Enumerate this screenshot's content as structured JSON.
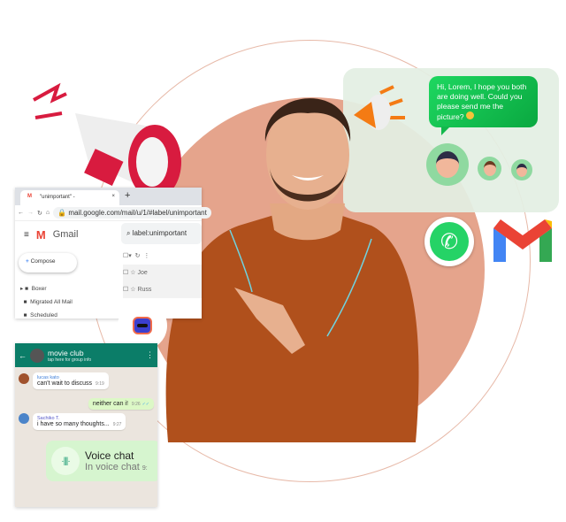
{
  "gmail": {
    "tab_title": "\"unimportant\" - ",
    "url": "mail.google.com/mail/u/1/#label/unimportant",
    "brand": "Gmail",
    "search_value": "label:unimportant",
    "compose_label": "Compose",
    "labels": [
      "Boxer",
      "Migrated All Mail",
      "Scheduled"
    ],
    "rows": [
      "Joe",
      "Russ"
    ]
  },
  "whatsapp": {
    "group_name": "movie club",
    "group_subtitle": "tap here for group info",
    "messages": [
      {
        "sender": "lucas kato",
        "text": "can't wait to discuss",
        "time": "9:19",
        "sender_color": "#3f7fd9"
      },
      {
        "text": "neither can i!",
        "time": "9:26"
      },
      {
        "sender": "Sachiko T.",
        "text": "i have so many thoughts...",
        "time": "9:27",
        "sender_color": "#5457c8"
      }
    ],
    "voice": {
      "title": "Voice chat",
      "subtitle": "In voice chat",
      "time": "9:"
    }
  },
  "chat_bubble": {
    "text": "Hi, Lorem, I hope you both are doing well. Could you please send me the picture?"
  },
  "colors": {
    "whatsapp_green": "#25d366",
    "header_green": "#0b7d68",
    "circle": "#e5a48c",
    "sweater": "#b0501c",
    "megaphone_red": "#d81b3f"
  },
  "icons": [
    "megaphone-icon",
    "whatsapp-icon",
    "gmail-icon",
    "robot-icon",
    "voice-waveform-icon"
  ]
}
